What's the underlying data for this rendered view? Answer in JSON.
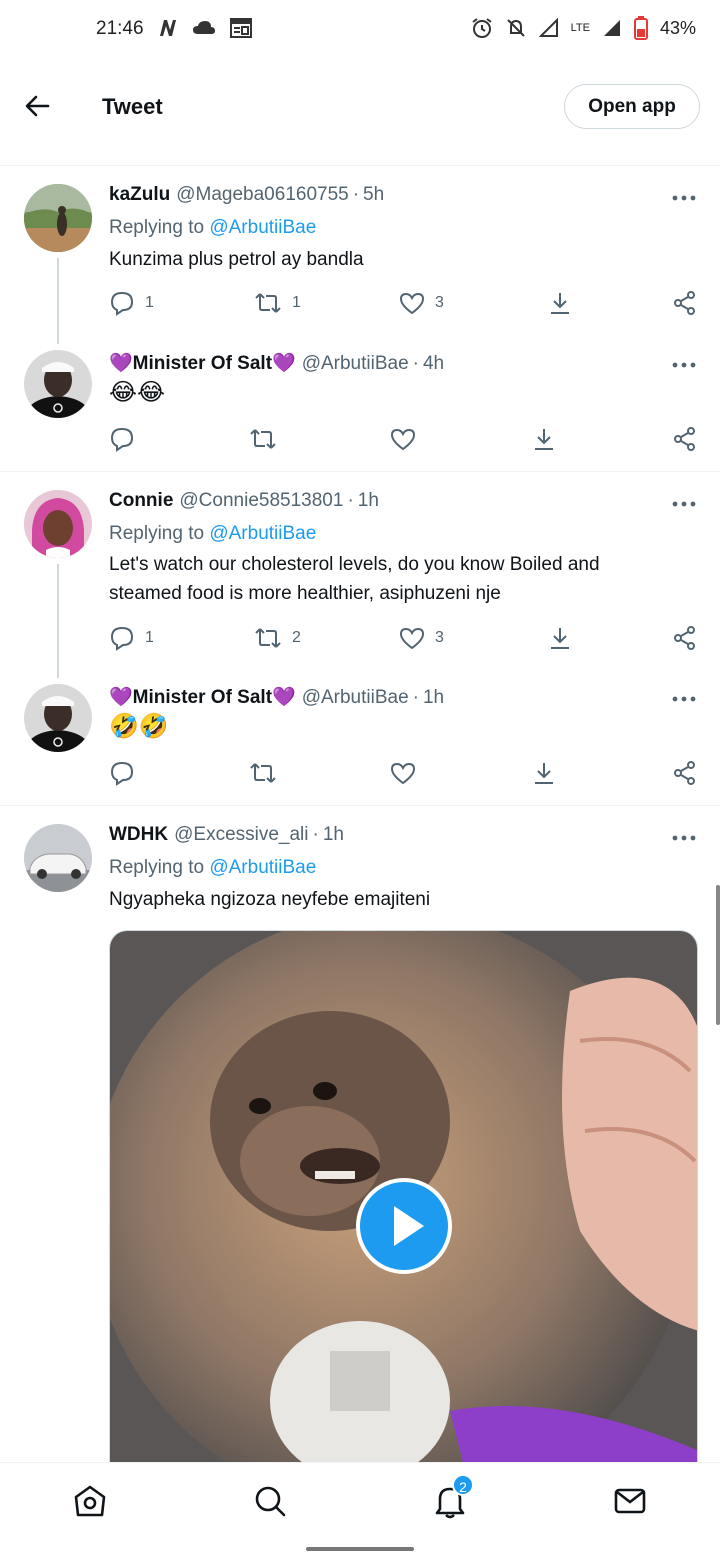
{
  "status_bar": {
    "time": "21:46",
    "battery": "43%",
    "network": "LTE"
  },
  "header": {
    "title": "Tweet",
    "open_app_label": "Open app"
  },
  "tweets": [
    {
      "name": "kaZulu",
      "handle": "@Mageba06160755",
      "time": "5h",
      "replying_prefix": "Replying to",
      "replying_to": "@ArbutiiBae",
      "text": "Kunzima plus petrol ay bandla",
      "replies": "1",
      "retweets": "1",
      "likes": "3"
    },
    {
      "name": "Minister Of Salt",
      "handle": "@ArbutiiBae",
      "time": "4h",
      "text": "😂😂"
    },
    {
      "name": "Connie",
      "handle": "@Connie58513801",
      "time": "1h",
      "replying_prefix": "Replying to",
      "replying_to": "@ArbutiiBae",
      "text_line1": "Let's watch our cholesterol levels, do you know Boiled and",
      "text_line2": "steamed food is more healthier, asiphuzeni nje",
      "replies": "1",
      "retweets": "2",
      "likes": "3"
    },
    {
      "name": "Minister Of Salt",
      "handle": "@ArbutiiBae",
      "time": "1h",
      "text": "🤣🤣"
    },
    {
      "name": "WDHK",
      "handle": "@Excessive_ali",
      "time": "1h",
      "replying_prefix": "Replying to",
      "replying_to": "@ArbutiiBae",
      "text": "Ngyapheka ngizoza neyfebe emajiteni"
    }
  ],
  "nav": {
    "notifications_badge": "2"
  },
  "colors": {
    "accent": "#1d9bf0",
    "muted": "#536471",
    "heart_purple": "#a78bdb"
  }
}
